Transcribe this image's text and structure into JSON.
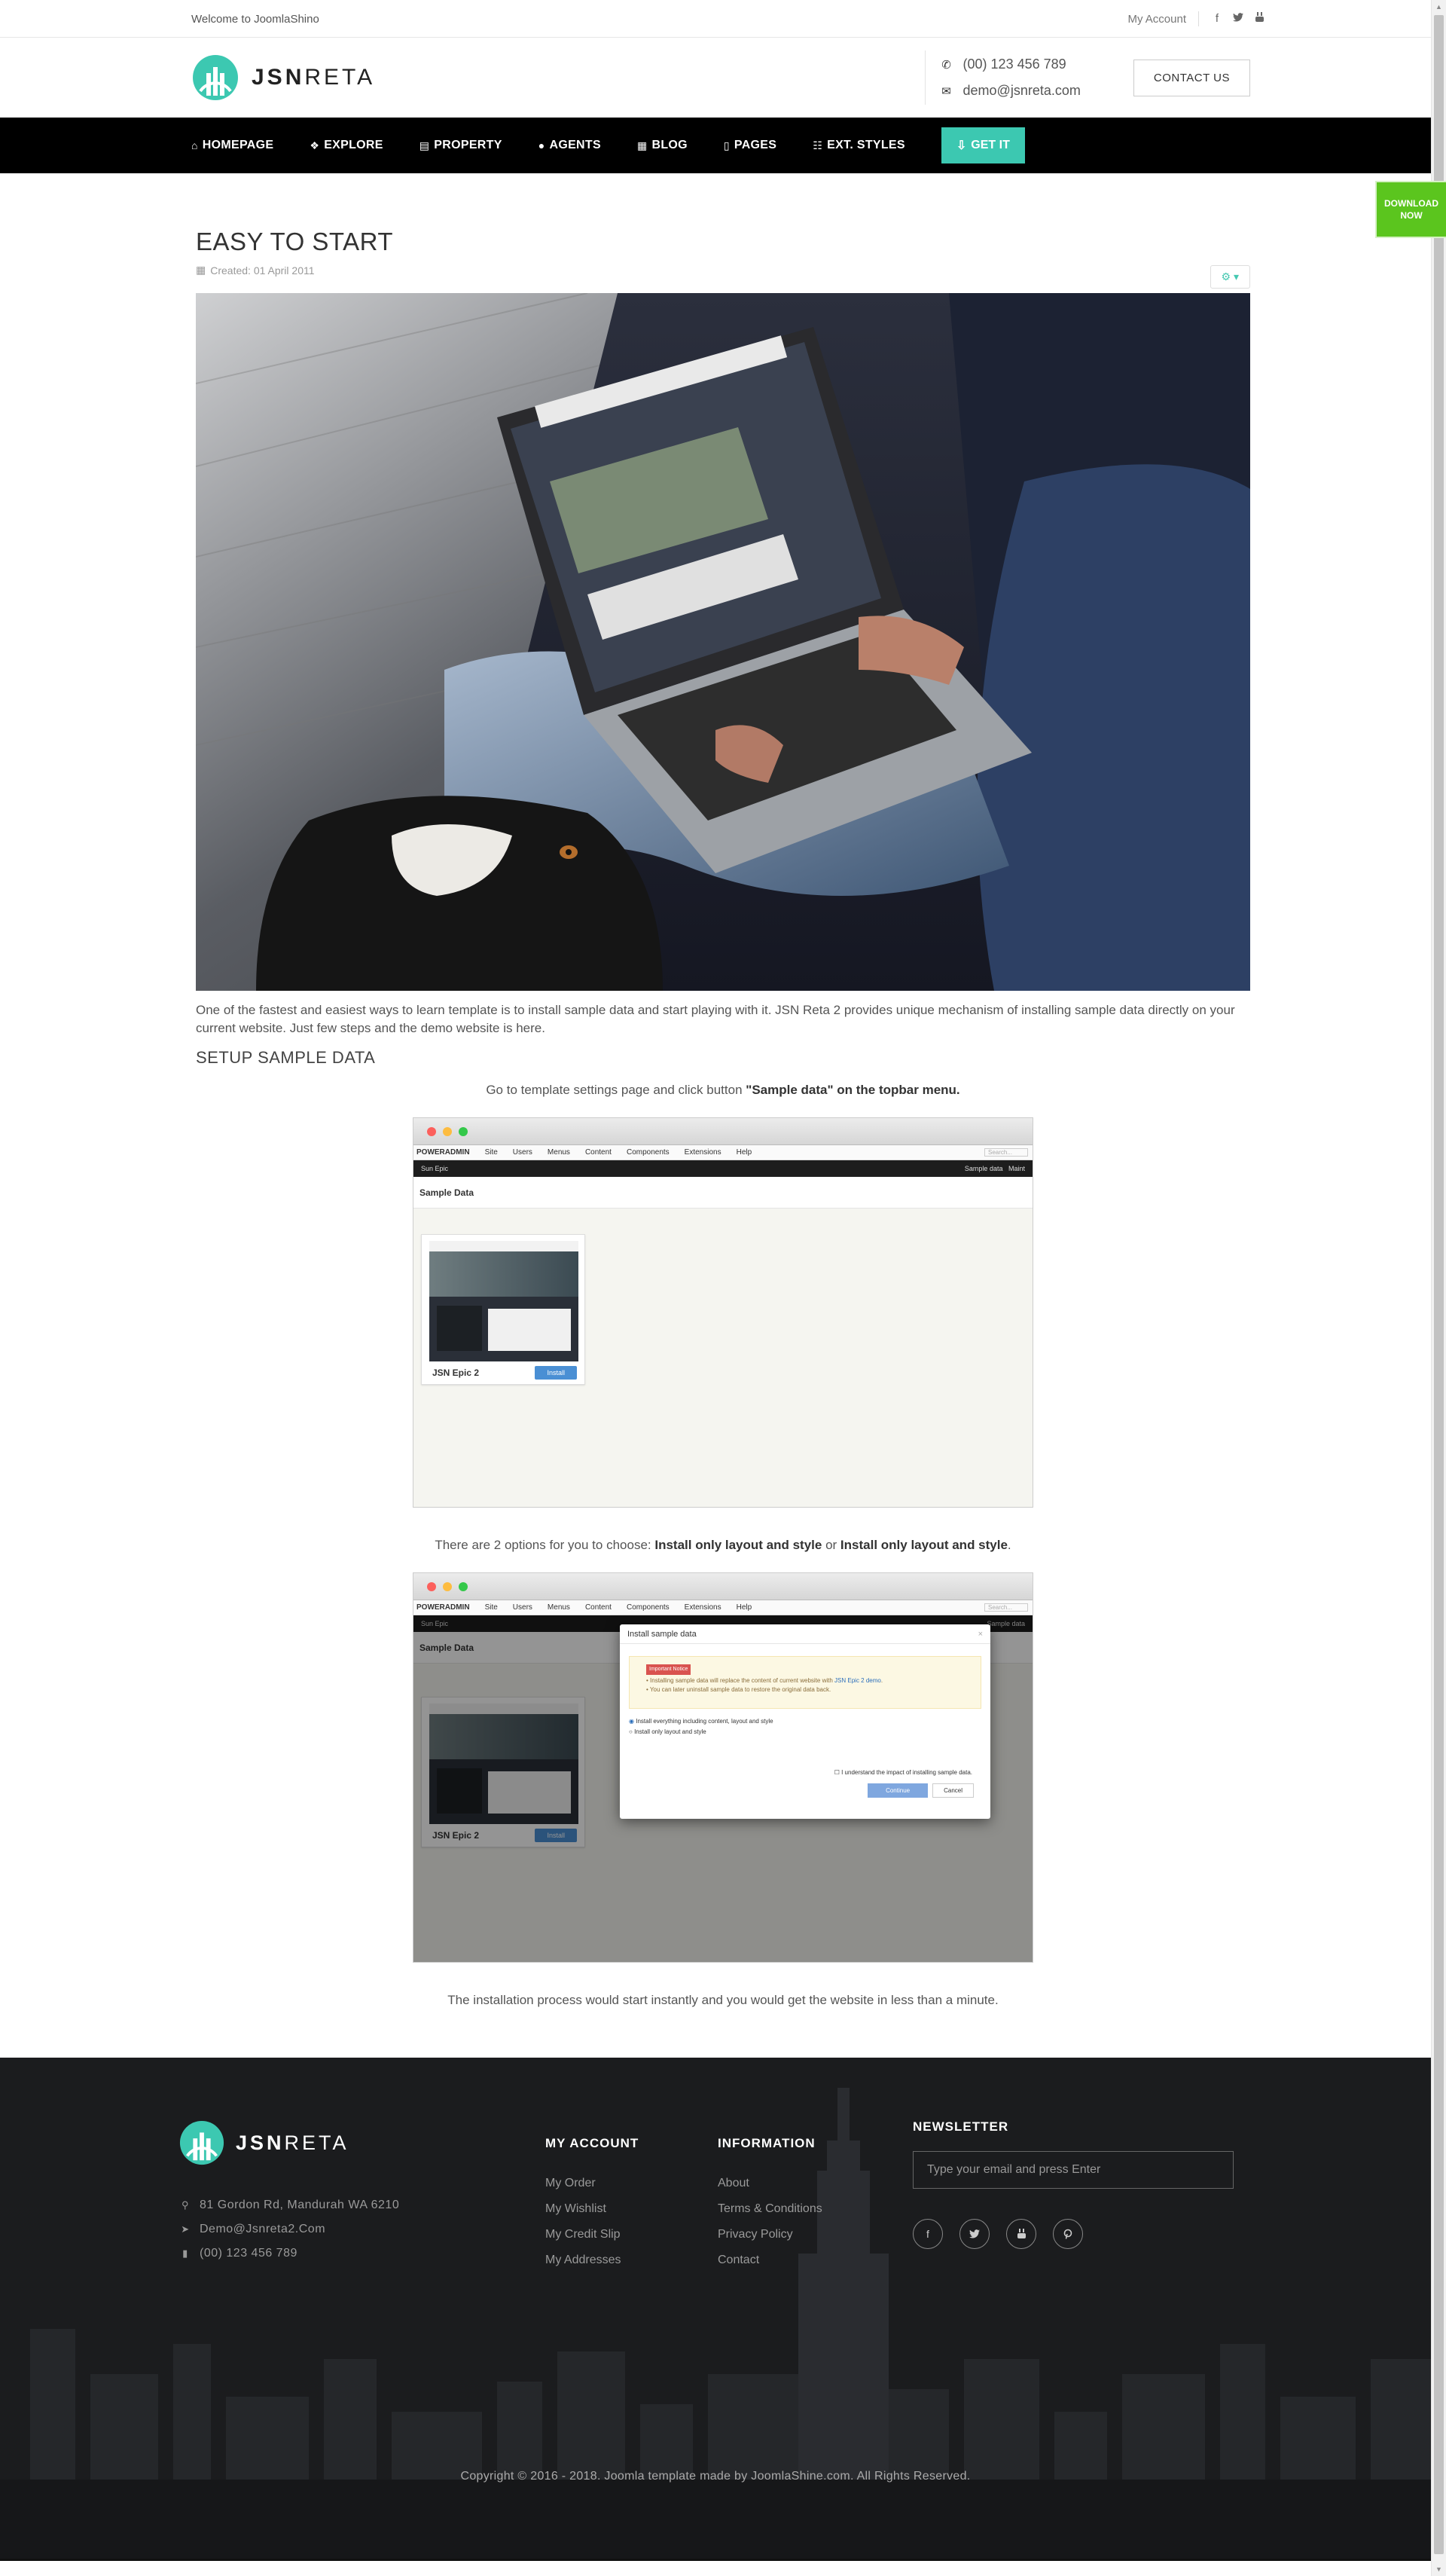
{
  "topbar": {
    "welcome": "Welcome to JoomlaShino",
    "my_account": "My Account",
    "social_icons": [
      "facebook-icon",
      "twitter-icon",
      "youtube-icon"
    ]
  },
  "header": {
    "logo_bold": "JSN",
    "logo_light": "RETA",
    "phone": "(00) 123 456 789",
    "email": "demo@jsnreta.com",
    "contact_button": "CONTACT US"
  },
  "nav": {
    "items": [
      {
        "label": "HOMEPAGE",
        "icon": "home-icon"
      },
      {
        "label": "EXPLORE",
        "icon": "cubes-icon"
      },
      {
        "label": "PROPERTY",
        "icon": "building-icon"
      },
      {
        "label": "AGENTS",
        "icon": "user-icon"
      },
      {
        "label": "BLOG",
        "icon": "newspaper-icon"
      },
      {
        "label": "PAGES",
        "icon": "file-icon"
      },
      {
        "label": "EXT. STYLES",
        "icon": "th-list-icon"
      }
    ],
    "get_it": "GET IT"
  },
  "download_now": {
    "line1": "DOWNLOAD",
    "line2": "NOW"
  },
  "article": {
    "title": "EASY TO START",
    "created": "Created: 01 April 2011",
    "intro": "One of the fastest and easiest ways to learn template is to install sample data and start playing with it. JSN Reta 2 provides unique mechanism of installing sample data directly on your current website. Just few steps and the demo website is here.",
    "setup_title": "SETUP SAMPLE DATA",
    "step1_prefix": "Go to template settings page and click button ",
    "step1_bold": "\"Sample data\" on the topbar menu.",
    "step2_prefix": "There are 2 options for you to choose: ",
    "step2_bold1": "Install only layout and style",
    "step2_mid": " or ",
    "step2_bold2": "Install only layout and style",
    "step2_suffix": ".",
    "closing": "The installation process would start instantly and you would get the website in less than a minute."
  },
  "admin_shot": {
    "brand": "POWERADMIN",
    "menu": [
      "Site",
      "Users",
      "Menus",
      "Content",
      "Components",
      "Extensions",
      "Help"
    ],
    "search_placeholder": "Search...",
    "site_name": "Sun Epic",
    "sample_data_link": "Sample data",
    "maintenance_link": "Maint",
    "page_title": "Sample Data",
    "template_name": "JSN Epic 2",
    "install_button": "Install"
  },
  "modal": {
    "title": "Install sample data",
    "close": "×",
    "notice_label": "Important Notice",
    "notice_line1_prefix": "Installing sample data will replace the content of current website with ",
    "notice_line1_link": "JSN Epic 2 demo",
    "notice_line1_suffix": ".",
    "notice_line2": "You can later uninstall sample data to restore the original data back.",
    "option1": "Install everything including content, layout and style",
    "option2": "Install only layout and style",
    "checkbox": "I understand the impact of installing sample data.",
    "continue": "Continue",
    "cancel": "Cancel"
  },
  "footer": {
    "logo_bold": "JSN",
    "logo_light": "RETA",
    "address": "81 Gordon Rd, Mandurah WA 6210",
    "email": "Demo@Jsnreta2.Com",
    "phone": "(00) 123 456 789",
    "my_account": {
      "title": "MY ACCOUNT",
      "links": [
        "My Order",
        "My Wishlist",
        "My Credit Slip",
        "My Addresses"
      ]
    },
    "information": {
      "title": "INFORMATION",
      "links": [
        "About",
        "Terms & Conditions",
        "Privacy Policy",
        "Contact"
      ]
    },
    "newsletter": {
      "title": "NEWSLETTER",
      "placeholder": "Type your email and press Enter"
    },
    "social_icons": [
      "facebook-icon",
      "twitter-icon",
      "youtube-icon",
      "pinterest-icon"
    ],
    "copyright": "Copyright © 2016 - 2018. Joomla template made by JoomlaShine.com. All Rights Reserved."
  },
  "colors": {
    "accent": "#3cc8b1",
    "download_green": "#5bc51e",
    "nav_bg": "#000000",
    "footer_bg": "#1a1b1d"
  }
}
